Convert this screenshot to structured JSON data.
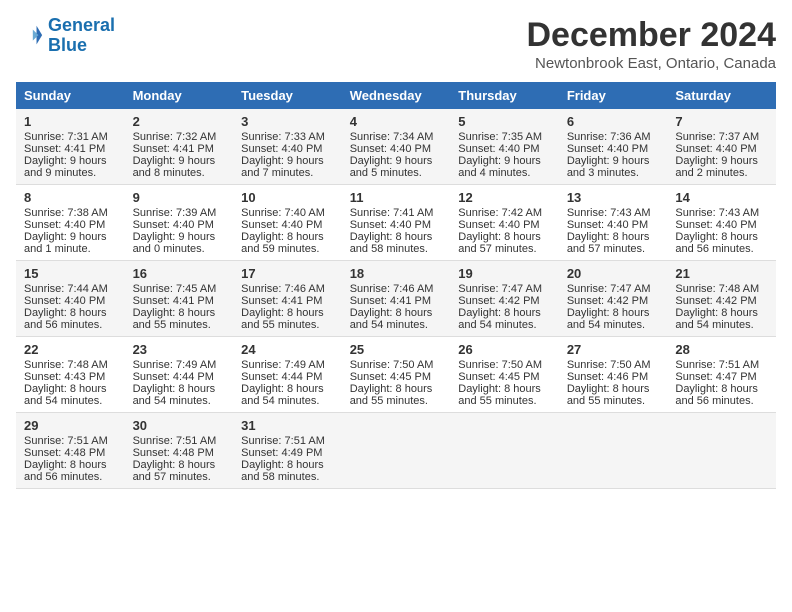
{
  "header": {
    "logo_line1": "General",
    "logo_line2": "Blue",
    "title": "December 2024",
    "subtitle": "Newtonbrook East, Ontario, Canada"
  },
  "days_of_week": [
    "Sunday",
    "Monday",
    "Tuesday",
    "Wednesday",
    "Thursday",
    "Friday",
    "Saturday"
  ],
  "weeks": [
    [
      {
        "day": 1,
        "sunrise": "7:31 AM",
        "sunset": "4:41 PM",
        "daylight": "9 hours and 9 minutes."
      },
      {
        "day": 2,
        "sunrise": "7:32 AM",
        "sunset": "4:41 PM",
        "daylight": "9 hours and 8 minutes."
      },
      {
        "day": 3,
        "sunrise": "7:33 AM",
        "sunset": "4:40 PM",
        "daylight": "9 hours and 7 minutes."
      },
      {
        "day": 4,
        "sunrise": "7:34 AM",
        "sunset": "4:40 PM",
        "daylight": "9 hours and 5 minutes."
      },
      {
        "day": 5,
        "sunrise": "7:35 AM",
        "sunset": "4:40 PM",
        "daylight": "9 hours and 4 minutes."
      },
      {
        "day": 6,
        "sunrise": "7:36 AM",
        "sunset": "4:40 PM",
        "daylight": "9 hours and 3 minutes."
      },
      {
        "day": 7,
        "sunrise": "7:37 AM",
        "sunset": "4:40 PM",
        "daylight": "9 hours and 2 minutes."
      }
    ],
    [
      {
        "day": 8,
        "sunrise": "7:38 AM",
        "sunset": "4:40 PM",
        "daylight": "9 hours and 1 minute."
      },
      {
        "day": 9,
        "sunrise": "7:39 AM",
        "sunset": "4:40 PM",
        "daylight": "9 hours and 0 minutes."
      },
      {
        "day": 10,
        "sunrise": "7:40 AM",
        "sunset": "4:40 PM",
        "daylight": "8 hours and 59 minutes."
      },
      {
        "day": 11,
        "sunrise": "7:41 AM",
        "sunset": "4:40 PM",
        "daylight": "8 hours and 58 minutes."
      },
      {
        "day": 12,
        "sunrise": "7:42 AM",
        "sunset": "4:40 PM",
        "daylight": "8 hours and 57 minutes."
      },
      {
        "day": 13,
        "sunrise": "7:43 AM",
        "sunset": "4:40 PM",
        "daylight": "8 hours and 57 minutes."
      },
      {
        "day": 14,
        "sunrise": "7:43 AM",
        "sunset": "4:40 PM",
        "daylight": "8 hours and 56 minutes."
      }
    ],
    [
      {
        "day": 15,
        "sunrise": "7:44 AM",
        "sunset": "4:40 PM",
        "daylight": "8 hours and 56 minutes."
      },
      {
        "day": 16,
        "sunrise": "7:45 AM",
        "sunset": "4:41 PM",
        "daylight": "8 hours and 55 minutes."
      },
      {
        "day": 17,
        "sunrise": "7:46 AM",
        "sunset": "4:41 PM",
        "daylight": "8 hours and 55 minutes."
      },
      {
        "day": 18,
        "sunrise": "7:46 AM",
        "sunset": "4:41 PM",
        "daylight": "8 hours and 54 minutes."
      },
      {
        "day": 19,
        "sunrise": "7:47 AM",
        "sunset": "4:42 PM",
        "daylight": "8 hours and 54 minutes."
      },
      {
        "day": 20,
        "sunrise": "7:47 AM",
        "sunset": "4:42 PM",
        "daylight": "8 hours and 54 minutes."
      },
      {
        "day": 21,
        "sunrise": "7:48 AM",
        "sunset": "4:42 PM",
        "daylight": "8 hours and 54 minutes."
      }
    ],
    [
      {
        "day": 22,
        "sunrise": "7:48 AM",
        "sunset": "4:43 PM",
        "daylight": "8 hours and 54 minutes."
      },
      {
        "day": 23,
        "sunrise": "7:49 AM",
        "sunset": "4:44 PM",
        "daylight": "8 hours and 54 minutes."
      },
      {
        "day": 24,
        "sunrise": "7:49 AM",
        "sunset": "4:44 PM",
        "daylight": "8 hours and 54 minutes."
      },
      {
        "day": 25,
        "sunrise": "7:50 AM",
        "sunset": "4:45 PM",
        "daylight": "8 hours and 55 minutes."
      },
      {
        "day": 26,
        "sunrise": "7:50 AM",
        "sunset": "4:45 PM",
        "daylight": "8 hours and 55 minutes."
      },
      {
        "day": 27,
        "sunrise": "7:50 AM",
        "sunset": "4:46 PM",
        "daylight": "8 hours and 55 minutes."
      },
      {
        "day": 28,
        "sunrise": "7:51 AM",
        "sunset": "4:47 PM",
        "daylight": "8 hours and 56 minutes."
      }
    ],
    [
      {
        "day": 29,
        "sunrise": "7:51 AM",
        "sunset": "4:48 PM",
        "daylight": "8 hours and 56 minutes."
      },
      {
        "day": 30,
        "sunrise": "7:51 AM",
        "sunset": "4:48 PM",
        "daylight": "8 hours and 57 minutes."
      },
      {
        "day": 31,
        "sunrise": "7:51 AM",
        "sunset": "4:49 PM",
        "daylight": "8 hours and 58 minutes."
      },
      null,
      null,
      null,
      null
    ]
  ]
}
